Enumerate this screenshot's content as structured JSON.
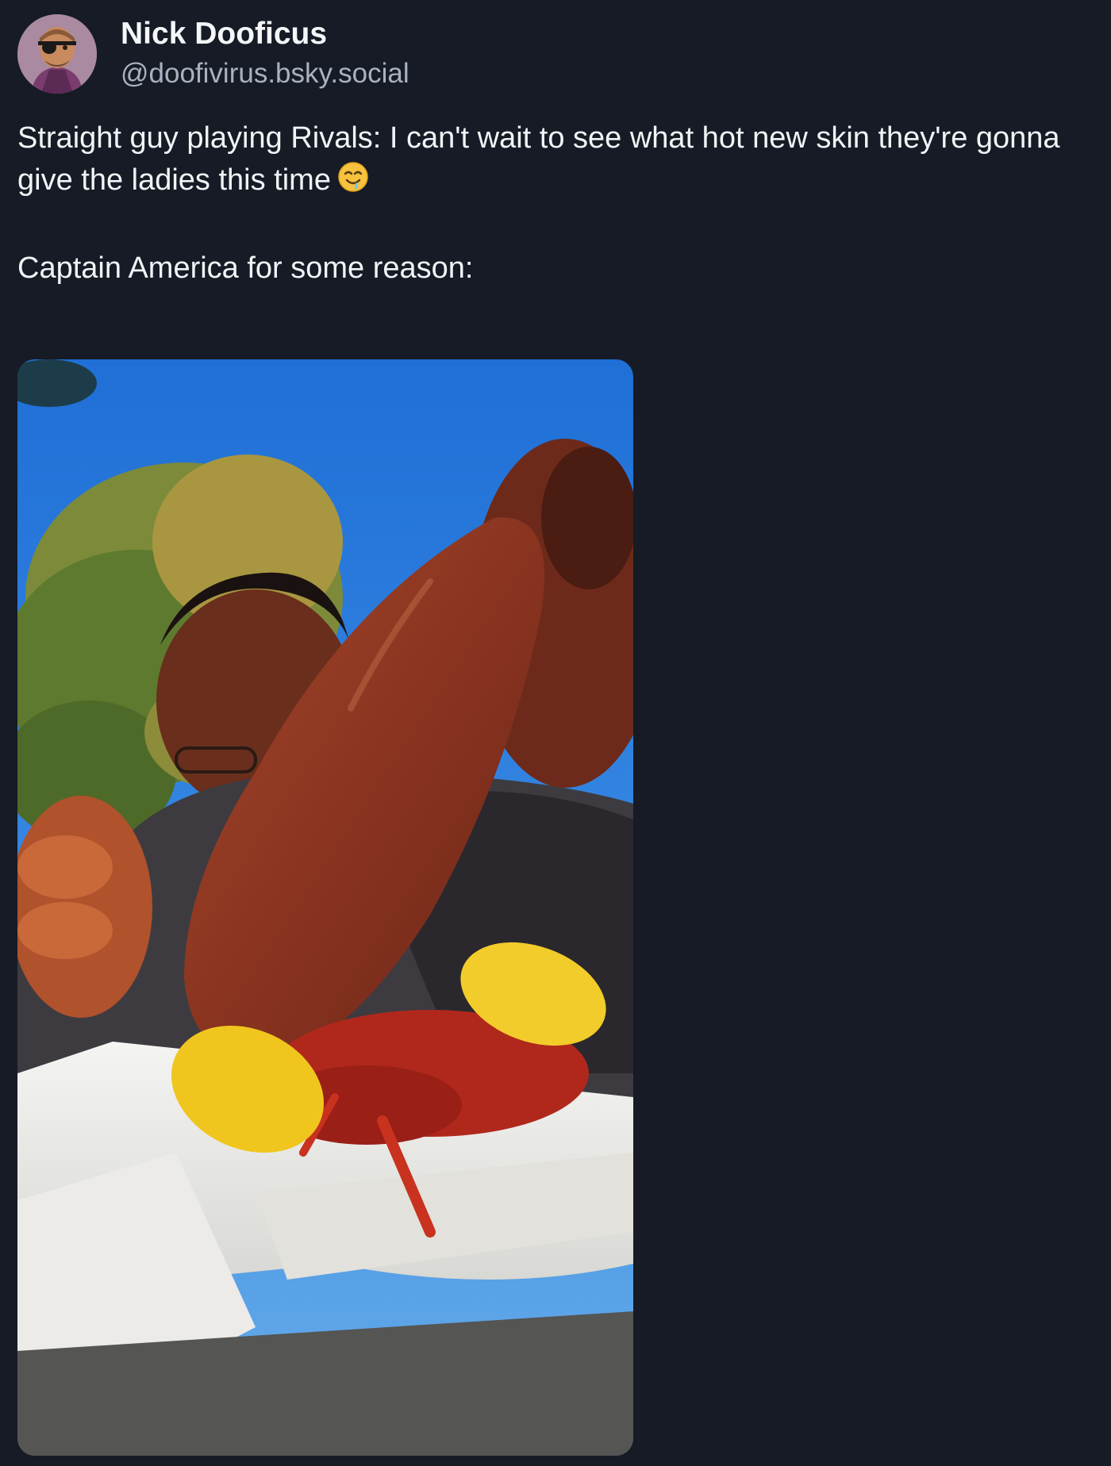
{
  "post": {
    "author": {
      "display_name": "Nick Dooficus",
      "handle": "@doofivirus.bsky.social",
      "avatar_icon": "avatar-illustration"
    },
    "text": {
      "line1": "Straight guy playing Rivals: I can't wait to see what hot new skin they're gonna give the ladies this time",
      "emoji": "drooling-face-emoji",
      "line2": "Captain America for some reason:"
    },
    "media": {
      "type": "photo"
    }
  },
  "colors": {
    "background": "#161b26",
    "text_primary": "#f1f3f5",
    "text_secondary": "#a9b2c0"
  }
}
